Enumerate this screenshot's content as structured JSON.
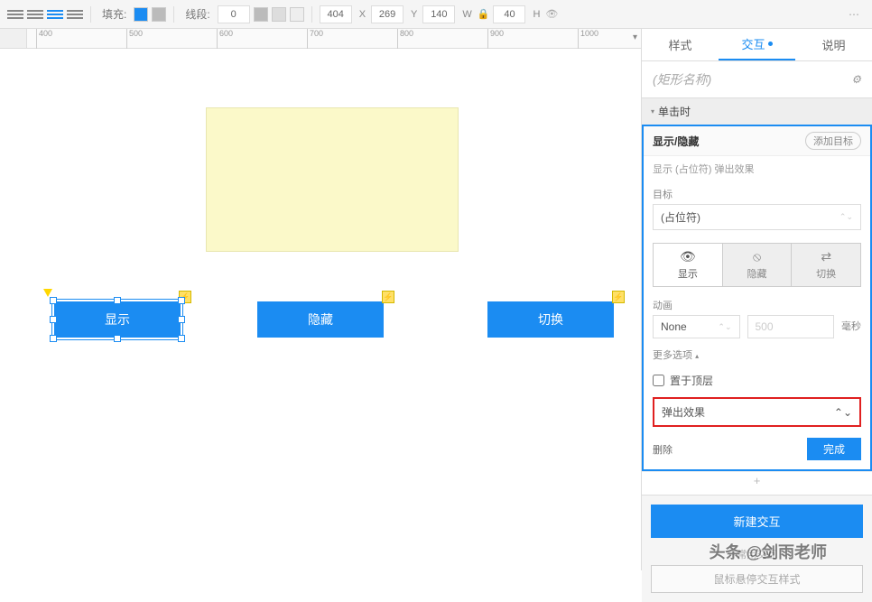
{
  "toolbar": {
    "fill_label": "填充:",
    "line_label": "线段:",
    "line_value": "0",
    "x_label": "X",
    "x_value": "404",
    "y_label": "Y",
    "y_value": "269",
    "w_label": "W",
    "w_value": "140",
    "h_label": "H",
    "h_value": "40"
  },
  "ruler_ticks": [
    "400",
    "500",
    "600",
    "700",
    "800",
    "900",
    "1000"
  ],
  "canvas": {
    "btn1": "显示",
    "btn2": "隐藏",
    "btn3": "切换"
  },
  "panel": {
    "tabs": {
      "style": "样式",
      "interact": "交互",
      "notes": "说明"
    },
    "shape_name_placeholder": "(矩形名称)",
    "event_header": "单击时",
    "action_title": "显示/隐藏",
    "add_target": "添加目标",
    "breadcrumb": "显示 (占位符)  弹出效果",
    "target_label": "目标",
    "target_value": "(占位符)",
    "toggles": {
      "show": "显示",
      "hide": "隐藏",
      "toggle": "切换"
    },
    "anim_label": "动画",
    "anim_value": "None",
    "duration_placeholder": "500",
    "duration_unit": "毫秒",
    "more_options": "更多选项",
    "bring_front": "置于顶层",
    "popup_effect": "弹出效果",
    "delete": "删除",
    "done": "完成",
    "new_interaction": "新建交互",
    "common_label": "常用交互",
    "hover_style": "鼠标悬停交互样式"
  },
  "watermark": "头条 @剑雨老师"
}
